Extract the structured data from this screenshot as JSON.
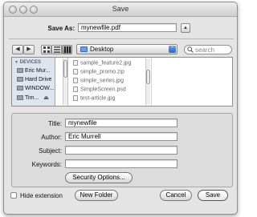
{
  "window": {
    "title": "Save"
  },
  "save_as": {
    "label": "Save As:",
    "value": "mynewfile.pdf",
    "expand_glyph": "▲"
  },
  "toolbar": {
    "back_glyph": "◀",
    "forward_glyph": "▶",
    "location": "Desktop",
    "location_glyph": "⌃",
    "search_placeholder": "search"
  },
  "sidebar": {
    "header": "DEVICES",
    "items": [
      {
        "label": "Eric Mur..."
      },
      {
        "label": "Hard Drive"
      },
      {
        "label": "WINDOW..."
      },
      {
        "label": "Tim...",
        "eject": "⏏"
      }
    ]
  },
  "files": [
    {
      "name": "sample_feature2.jpg"
    },
    {
      "name": "simple_promo.zip"
    },
    {
      "name": "simple_series.jpg"
    },
    {
      "name": "SimpleScreen.psd"
    },
    {
      "name": "test-article.jpg"
    }
  ],
  "metadata": {
    "title_label": "Title:",
    "title_value": "mynewfile",
    "author_label": "Author:",
    "author_value": "Eric Murrell",
    "subject_label": "Subject:",
    "subject_value": "",
    "keywords_label": "Keywords:",
    "keywords_value": "",
    "security_button": "Security Options..."
  },
  "footer": {
    "hide_extension_label": "Hide extension",
    "hide_extension_checked": false,
    "new_folder_button": "New Folder",
    "cancel_button": "Cancel",
    "save_button": "Save"
  }
}
